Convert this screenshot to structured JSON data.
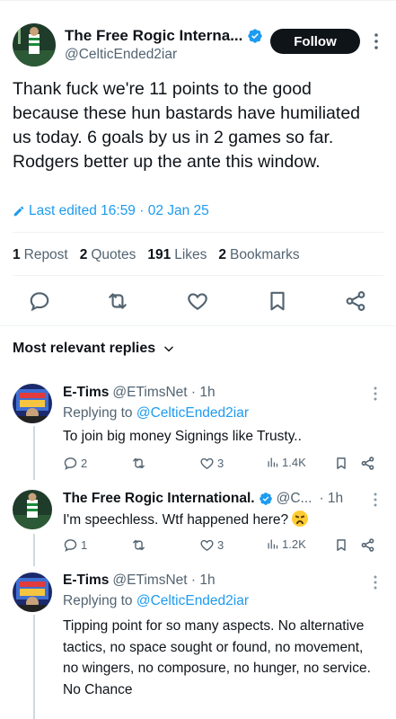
{
  "main_tweet": {
    "display_name": "The Free Rogic Interna...",
    "handle": "@CelticEnded2iar",
    "follow_label": "Follow",
    "text": "Thank fuck we're 11 points to the good because these hun bastards have humiliated us today. 6 goals by us in 2 games so far. Rodgers better up the ante this window.",
    "edited_label": "Last edited 16:59 · 02 Jan 25",
    "stats": {
      "reposts_count": "1",
      "reposts_label": "Repost",
      "quotes_count": "2",
      "quotes_label": "Quotes",
      "likes_count": "191",
      "likes_label": "Likes",
      "bookmarks_count": "2",
      "bookmarks_label": "Bookmarks"
    }
  },
  "replies_header": "Most relevant replies",
  "replies": [
    {
      "name": "E-Tims",
      "handle_time": "@ETimsNet · 1h",
      "replying_prefix": "Replying to",
      "replying_to": "@CelticEnded2iar",
      "text": "To join big money Signings like Trusty..",
      "reply_count": "2",
      "repost_count": "",
      "like_count": "3",
      "views": "1.4K"
    },
    {
      "name": "The Free Rogic International.",
      "handle_time": "@C...",
      "time": "· 1h",
      "text": "I'm speechless. Wtf happened here?",
      "reply_count": "1",
      "repost_count": "",
      "like_count": "3",
      "views": "1.2K"
    },
    {
      "name": "E-Tims",
      "handle_time": "@ETimsNet · 1h",
      "replying_prefix": "Replying to",
      "replying_to": "@CelticEnded2iar",
      "text": "Tipping point for so many aspects. No alternative tactics, no space sought or found, no movement, no wingers, no composure, no hunger, no service. No Chance"
    }
  ],
  "colors": {
    "accent": "#1d9bf0",
    "text": "#0f1419",
    "secondary": "#536471",
    "follow_bg": "#0f1419"
  }
}
